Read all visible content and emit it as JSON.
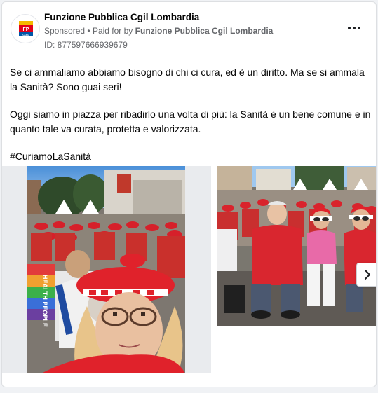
{
  "post": {
    "page_name": "Funzione Pubblica Cgil Lombardia",
    "sponsored": "Sponsored",
    "separator": "•",
    "paid_for_prefix": "Paid for by",
    "paid_for_by": "Funzione Pubblica Cgil Lombardia",
    "ad_id": "ID: 877597666939679",
    "avatar_logo_text": "FP CGIL",
    "text": {
      "paragraph1": "Se ci ammaliamo abbiamo bisogno di chi ci cura, ed è un diritto. Ma se si ammala la Sanità? Sono guai seri!",
      "paragraph2": "Oggi siamo in piazza per ribadirlo una volta di più: la Sanità è un bene comune e in quanto tale va curata, protetta e valorizzata.",
      "hashtag": "#CuriamoLaSanità"
    },
    "photo1_banner_text": "HEALTH PEOPLE"
  },
  "icons": {
    "more": "more-options-icon",
    "next": "chevron-right-icon"
  },
  "colors": {
    "brand_red": "#e2001a",
    "text_primary": "#050505",
    "text_secondary": "#65676b"
  }
}
